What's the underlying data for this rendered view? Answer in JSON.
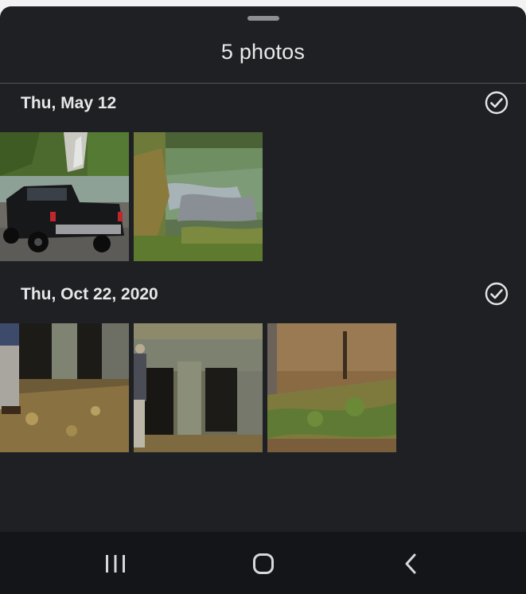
{
  "sheet": {
    "title": "5 photos"
  },
  "groups": [
    {
      "date": "Thu, May 12",
      "selected": true,
      "photos": [
        "truck-by-pond-photo",
        "pond-water-photo"
      ]
    },
    {
      "date": "Thu, Oct 22, 2020",
      "selected": true,
      "photos": [
        "man-at-ruins-photo",
        "stone-ruins-photo",
        "forest-slope-photo"
      ]
    }
  ],
  "navbar": {
    "buttons": [
      "recent-apps-icon",
      "home-icon",
      "back-icon"
    ]
  },
  "colors": {
    "sheet_bg": "#1f2023",
    "navbar_bg": "#141518",
    "text": "#e7e7e8"
  }
}
